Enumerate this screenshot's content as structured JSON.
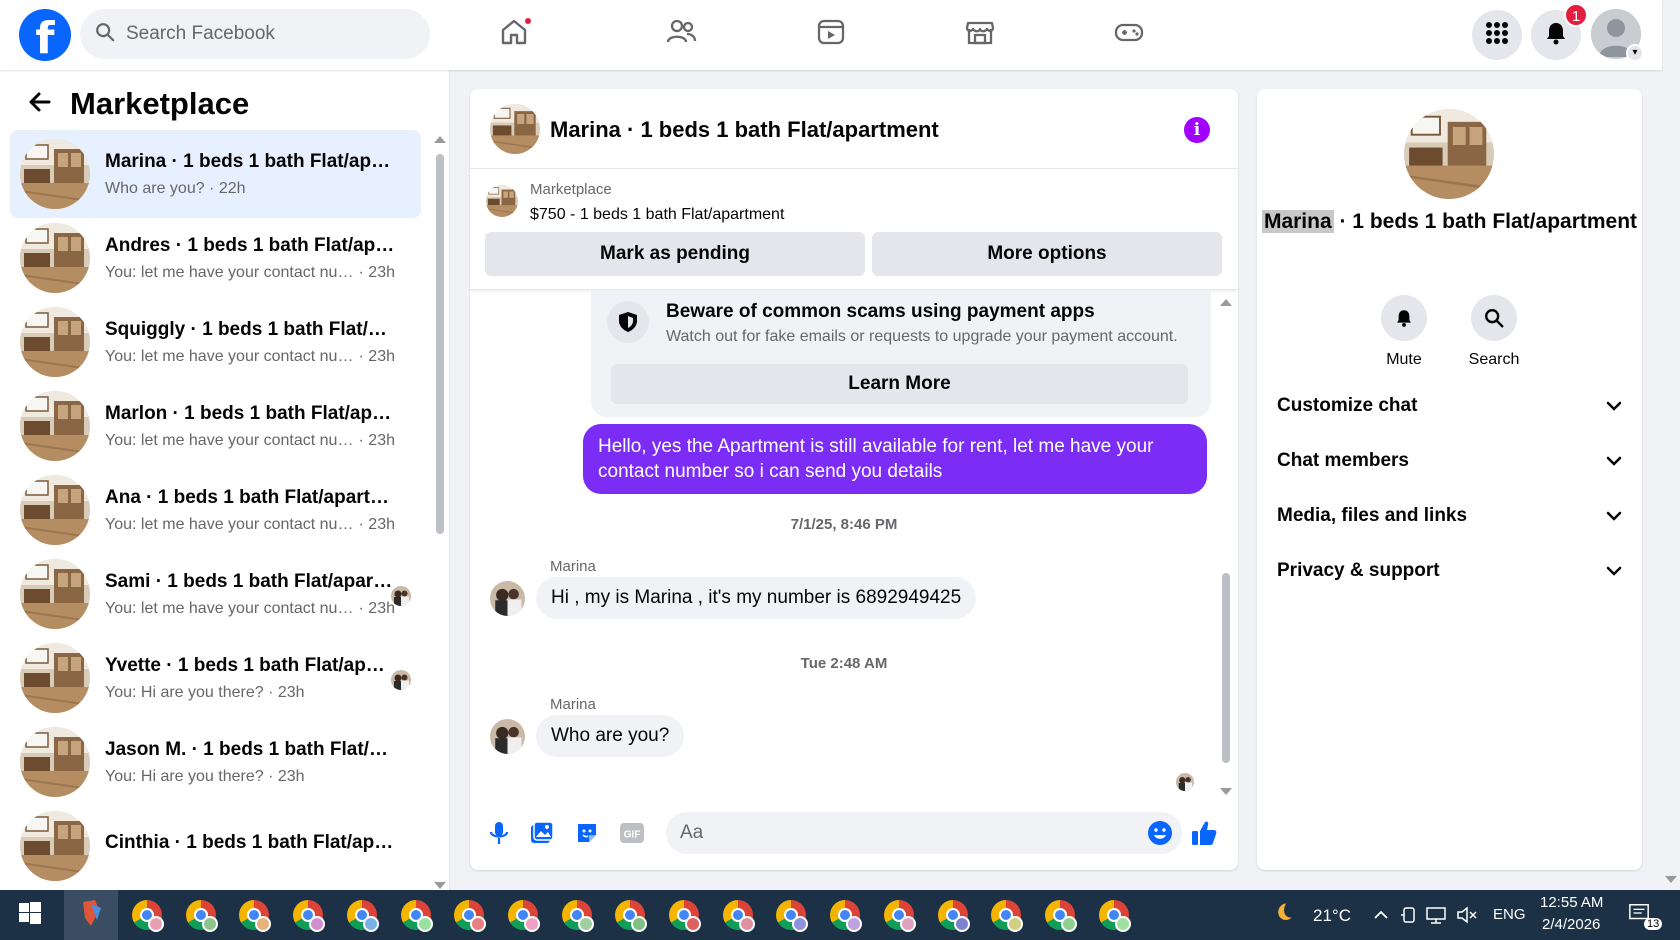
{
  "topnav": {
    "logo_letter": "f",
    "search_placeholder": "Search Facebook",
    "icons": [
      "home-icon",
      "friends-icon",
      "video-icon",
      "marketplace-icon",
      "gaming-icon"
    ],
    "notification_count": "1"
  },
  "left": {
    "title": "Marketplace",
    "conversations": [
      {
        "name": "Marina · 1 beds 1 bath Flat/apartment",
        "preview": "Who are you?",
        "time": "22h",
        "active": true
      },
      {
        "name": "Andres · 1 beds 1 bath Flat/apartment",
        "preview": "You: let me have your contact number so i can send you details",
        "time": "23h"
      },
      {
        "name": "Squiggly · 1 beds 1 bath Flat/apartment",
        "preview": "You: let me have your contact number so i can send you details",
        "time": "23h"
      },
      {
        "name": "Marlon · 1 beds 1 bath Flat/apartment",
        "preview": "You: let me have your contact number so i can send you details",
        "time": "23h"
      },
      {
        "name": "Ana · 1 beds 1 bath Flat/apartment",
        "preview": "You: let me have your contact number so i can send you details",
        "time": "23h"
      },
      {
        "name": "Sami · 1 beds 1 bath Flat/apartment",
        "preview": "You: let me have your contact number so i can send you details",
        "time": "23h",
        "read": true
      },
      {
        "name": "Yvette · 1 beds 1 bath Flat/apartment",
        "preview": "You: Hi are you there?",
        "time": "23h",
        "read": true
      },
      {
        "name": "Jason M. · 1 beds 1 bath Flat/apartment",
        "preview": "You: Hi are you there?",
        "time": "23h"
      },
      {
        "name": "Cinthia · 1 beds 1 bath Flat/apartment",
        "preview": "",
        "time": ""
      }
    ]
  },
  "chat": {
    "title": "Marina · 1 beds 1 bath Flat/apartment",
    "listing_label": "Marketplace",
    "listing_desc": "$750 - 1 beds 1 bath Flat/apartment",
    "mark_pending": "Mark as pending",
    "more_options": "More options",
    "scam_title": "Beware of common scams using payment apps",
    "scam_body": "Watch out for fake emails or requests to upgrade your payment account.",
    "learn_more": "Learn More",
    "outgoing_message": "Hello, yes the Apartment is still available for rent, let me have your contact number so i can send you details",
    "timestamp1": "7/1/25, 8:46 PM",
    "sender1": "Marina",
    "incoming1": "Hi , my is Marina , it's my number is 6892949425",
    "timestamp2": "Tue 2:48 AM",
    "sender2": "Marina",
    "incoming2": "Who are you?",
    "composer_placeholder": "Aa",
    "gif_label": "GIF"
  },
  "right": {
    "title_name": "Marina",
    "title_rest": " · 1 beds 1 bath Flat/apartment",
    "mute": "Mute",
    "search": "Search",
    "sections": [
      "Customize chat",
      "Chat members",
      "Media, files and links",
      "Privacy & support"
    ]
  },
  "taskbar": {
    "temperature": "21°C",
    "language": "ENG",
    "time": "12:55 AM",
    "date": "2/4/2026",
    "notification_count": "13",
    "chrome_badge_colors": [
      "#e8a0b4",
      "#8fc48f",
      "#e8b07a",
      "#d08fd0",
      "#7ab0e8",
      "#9be0a0",
      "#e88080",
      "#f0a0c0",
      "#a0d0a0",
      "#80c080",
      "#e06060",
      "#e090a0",
      "#9090e0",
      "#c0a0e0",
      "#e0a0c0",
      "#8080d0",
      "#d0d080",
      "#90d090",
      "#a0e0a0"
    ]
  },
  "colors": {
    "brand": "#0866ff",
    "outgoing_bubble": "#7b2cf5",
    "info": "#a200ff",
    "active_row": "#e7f0ff"
  }
}
